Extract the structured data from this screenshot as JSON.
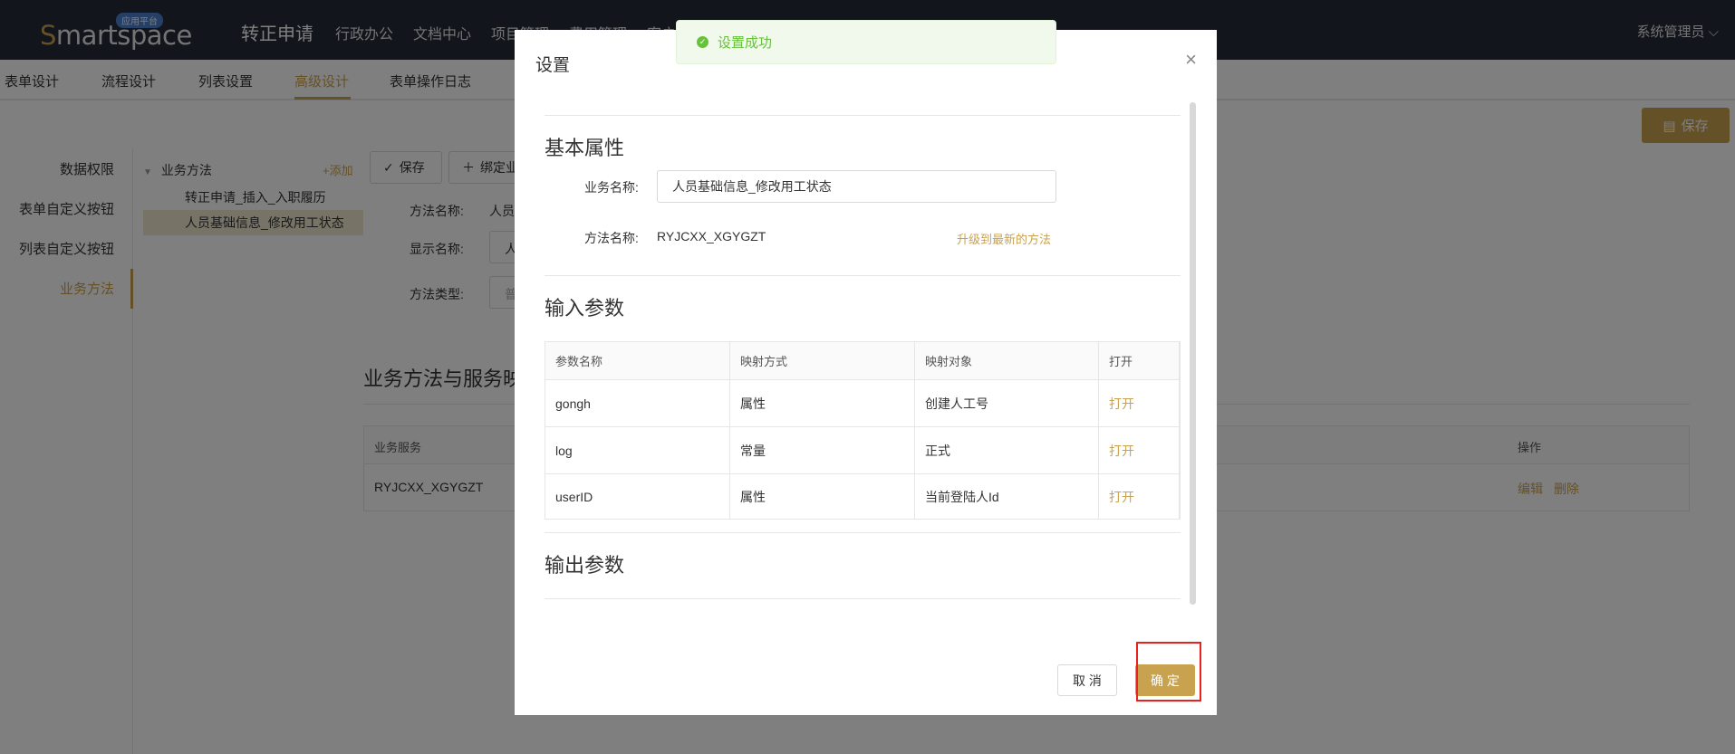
{
  "topbar": {
    "logo_text": "Smartspace",
    "logo_badge": "应用平台",
    "app_title": "转正申请",
    "nav": [
      "行政办公",
      "文档中心",
      "项目管理",
      "费用管理",
      "客户管"
    ],
    "user": "系统管理员"
  },
  "subtabs": [
    "表单设计",
    "流程设计",
    "列表设置",
    "高级设计",
    "表单操作日志"
  ],
  "save_top": "保存",
  "left_menu": [
    "数据权限",
    "表单自定义按钮",
    "列表自定义按钮",
    "业务方法"
  ],
  "tree": {
    "root": "业务方法",
    "add": "+添加",
    "nodes": [
      "转正申请_插入_入职履历",
      "人员基础信息_修改用工状态"
    ]
  },
  "toolbar": {
    "save": "保存",
    "bind": "绑定业"
  },
  "form": {
    "method_name_label": "方法名称:",
    "method_name_value": "人员",
    "display_name_label": "显示名称:",
    "display_name_value": "人",
    "method_type_label": "方法类型:",
    "method_type_value": "普"
  },
  "mapping_section": {
    "title": "业务方法与服务映",
    "headers": [
      "业务服务",
      "操作"
    ],
    "row": {
      "service": "RYJCXX_XGYGZT",
      "edit": "编辑",
      "delete": "删除"
    }
  },
  "modal": {
    "title": "设置",
    "basic_title": "基本属性",
    "biz_name_label": "业务名称:",
    "biz_name_value": "人员基础信息_修改用工状态",
    "method_name_label": "方法名称:",
    "method_name_value": "RYJCXX_XGYGZT",
    "upgrade_link": "升级到最新的方法",
    "input_title": "输入参数",
    "input_headers": [
      "参数名称",
      "映射方式",
      "映射对象",
      "打开"
    ],
    "input_rows": [
      {
        "name": "gongh",
        "mode": "属性",
        "target": "创建人工号",
        "open": "打开"
      },
      {
        "name": "log",
        "mode": "常量",
        "target": "正式",
        "open": "打开"
      },
      {
        "name": "userID",
        "mode": "属性",
        "target": "当前登陆人Id",
        "open": "打开"
      }
    ],
    "output_title": "输出参数",
    "cancel": "取 消",
    "ok": "确 定"
  },
  "toast": {
    "text": "设置成功"
  },
  "colors": {
    "accent": "#c9a24f",
    "topbar": "#242a38",
    "success": "#67c23a",
    "highlight": "#e8231e"
  }
}
